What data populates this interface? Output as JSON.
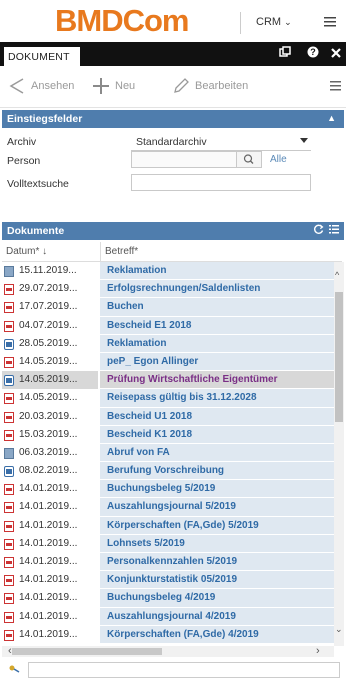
{
  "app": {
    "logo": "BMDCom",
    "module": "CRM",
    "module_chevron": "⌄"
  },
  "tab": {
    "label": "DOKUMENT"
  },
  "toolbar": {
    "view_label": "Ansehen",
    "new_label": "Neu",
    "edit_label": "Bearbeiten"
  },
  "entry": {
    "title": "Einstiegsfelder",
    "archiv_label": "Archiv",
    "archiv_value": "Standardarchiv",
    "person_label": "Person",
    "person_value": "",
    "alle_label": "Alle",
    "fulltext_label": "Volltextsuche",
    "fulltext_value": ""
  },
  "documents": {
    "title": "Dokumente",
    "col_date": "Datum*",
    "col_subject": "Betreff*",
    "rows": [
      {
        "icon": "img",
        "date": "15.11.2019...",
        "subject": "Reklamation"
      },
      {
        "icon": "pdf",
        "date": "29.07.2019...",
        "subject": "Erfolgsrechnungen/Saldenlisten"
      },
      {
        "icon": "pdf",
        "date": "17.07.2019...",
        "subject": "Buchen"
      },
      {
        "icon": "pdf",
        "date": "04.07.2019...",
        "subject": "Bescheid E1 2018"
      },
      {
        "icon": "msg",
        "date": "28.05.2019...",
        "subject": "Reklamation"
      },
      {
        "icon": "pdf",
        "date": "14.05.2019...",
        "subject": "peP_ Egon Allinger"
      },
      {
        "icon": "msg",
        "date": "14.05.2019...",
        "subject": "Prüfung Wirtschaftliche Eigentümer",
        "selected": true
      },
      {
        "icon": "pdf",
        "date": "14.05.2019...",
        "subject": "Reisepass gültig bis 31.12.2028"
      },
      {
        "icon": "pdf",
        "date": "20.03.2019...",
        "subject": "Bescheid U1 2018"
      },
      {
        "icon": "pdf",
        "date": "15.03.2019...",
        "subject": "Bescheid K1 2018"
      },
      {
        "icon": "img",
        "date": "06.03.2019...",
        "subject": "Abruf von FA"
      },
      {
        "icon": "msg",
        "date": "08.02.2019...",
        "subject": "Berufung Vorschreibung"
      },
      {
        "icon": "pdf",
        "date": "14.01.2019...",
        "subject": "Buchungsbeleg 5/2019"
      },
      {
        "icon": "pdf",
        "date": "14.01.2019...",
        "subject": "Auszahlungsjournal 5/2019"
      },
      {
        "icon": "pdf",
        "date": "14.01.2019...",
        "subject": "Körperschaften (FA,Gde) 5/2019"
      },
      {
        "icon": "pdf",
        "date": "14.01.2019...",
        "subject": "Lohnsets 5/2019"
      },
      {
        "icon": "pdf",
        "date": "14.01.2019...",
        "subject": "Personalkennzahlen 5/2019"
      },
      {
        "icon": "pdf",
        "date": "14.01.2019...",
        "subject": "Konjunkturstatistik 05/2019"
      },
      {
        "icon": "pdf",
        "date": "14.01.2019...",
        "subject": "Buchungsbeleg 4/2019"
      },
      {
        "icon": "pdf",
        "date": "14.01.2019...",
        "subject": "Auszahlungsjournal 4/2019"
      },
      {
        "icon": "pdf",
        "date": "14.01.2019...",
        "subject": "Körperschaften (FA,Gde) 4/2019"
      }
    ]
  },
  "colors": {
    "brand": "#e8791e",
    "section": "#4f7dad",
    "link": "#2f6aa6",
    "selected_text": "#7a2f86",
    "row_bg": "#dfe8f1"
  }
}
